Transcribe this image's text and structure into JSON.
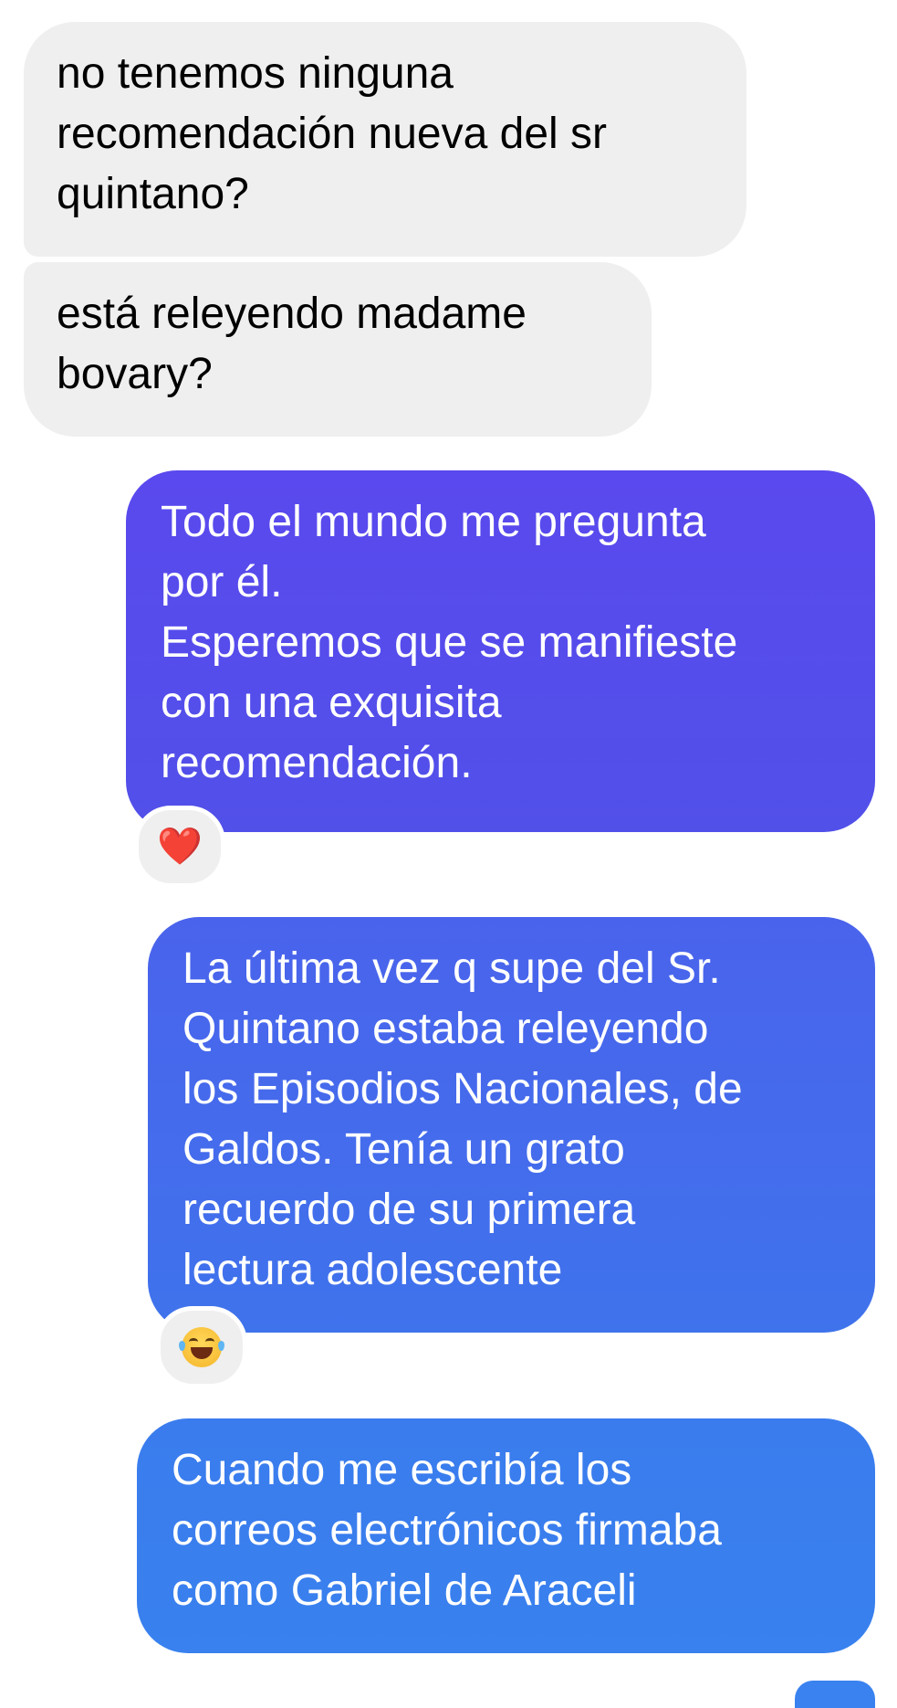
{
  "conversation": {
    "messages": [
      {
        "direction": "incoming",
        "text": "no tenemos ninguna\nrecomendación nueva del sr\nquintano?"
      },
      {
        "direction": "incoming",
        "text": "está releyendo madame\nbovary?"
      },
      {
        "direction": "outgoing",
        "text": "Todo el mundo me pregunta\npor él.\nEsperemos que se manifieste\ncon una exquisita\nrecomendación.",
        "reaction": "❤️"
      },
      {
        "direction": "outgoing",
        "text": "La última vez q supe del Sr.\nQuintano estaba releyendo\nlos Episodios Nacionales, de\nGaldos. Tenía un grato\nrecuerdo de su primera\nlectura adolescente",
        "reaction": "😂"
      },
      {
        "direction": "outgoing",
        "text": "Cuando me escribía los\ncorreos electrónicos firmaba\ncomo Gabriel de Araceli"
      }
    ]
  },
  "colors": {
    "incoming_bubble": "#efefef",
    "outgoing_gradient_top": "#5a49ee",
    "outgoing_gradient_bottom": "#3981ef"
  },
  "icons": {
    "reaction_1": "heart-icon",
    "reaction_2": "face-with-tears-of-joy-icon"
  }
}
